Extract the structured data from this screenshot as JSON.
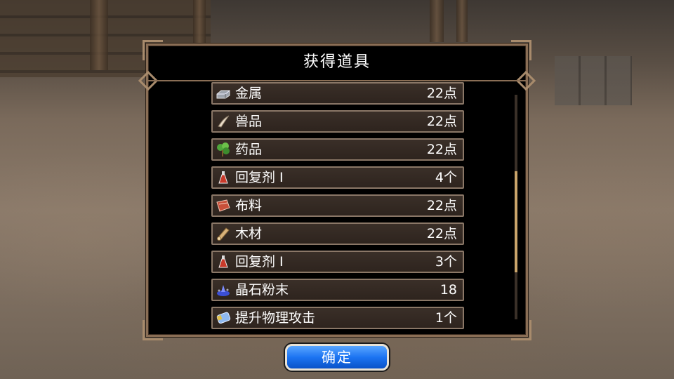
{
  "dialog": {
    "title": "获得道具"
  },
  "items": [
    {
      "name": "金属",
      "qty": "22点",
      "icon": "metal-ingot-icon"
    },
    {
      "name": "兽品",
      "qty": "22点",
      "icon": "beast-claw-icon"
    },
    {
      "name": "药品",
      "qty": "22点",
      "icon": "herb-icon"
    },
    {
      "name": "回复剂 I",
      "qty": "4个",
      "icon": "potion-flask-icon"
    },
    {
      "name": "布料",
      "qty": "22点",
      "icon": "cloth-icon"
    },
    {
      "name": "木材",
      "qty": "22点",
      "icon": "wood-log-icon"
    },
    {
      "name": "回复剂 I",
      "qty": "3个",
      "icon": "potion-flask-icon"
    },
    {
      "name": "晶石粉末",
      "qty": "18",
      "icon": "crystal-powder-icon"
    },
    {
      "name": "提升物理攻击",
      "qty": "1个",
      "icon": "attack-boost-icon"
    }
  ],
  "scroll": {
    "position_fraction": 0.62,
    "visible_fraction": 0.45
  },
  "confirm": {
    "label": "确定"
  },
  "colors": {
    "panel_border": "#8a6e55",
    "item_bg": "#3a2f28",
    "button_blue": "#1c74f2",
    "scroll_thumb": "#c9a46a"
  }
}
